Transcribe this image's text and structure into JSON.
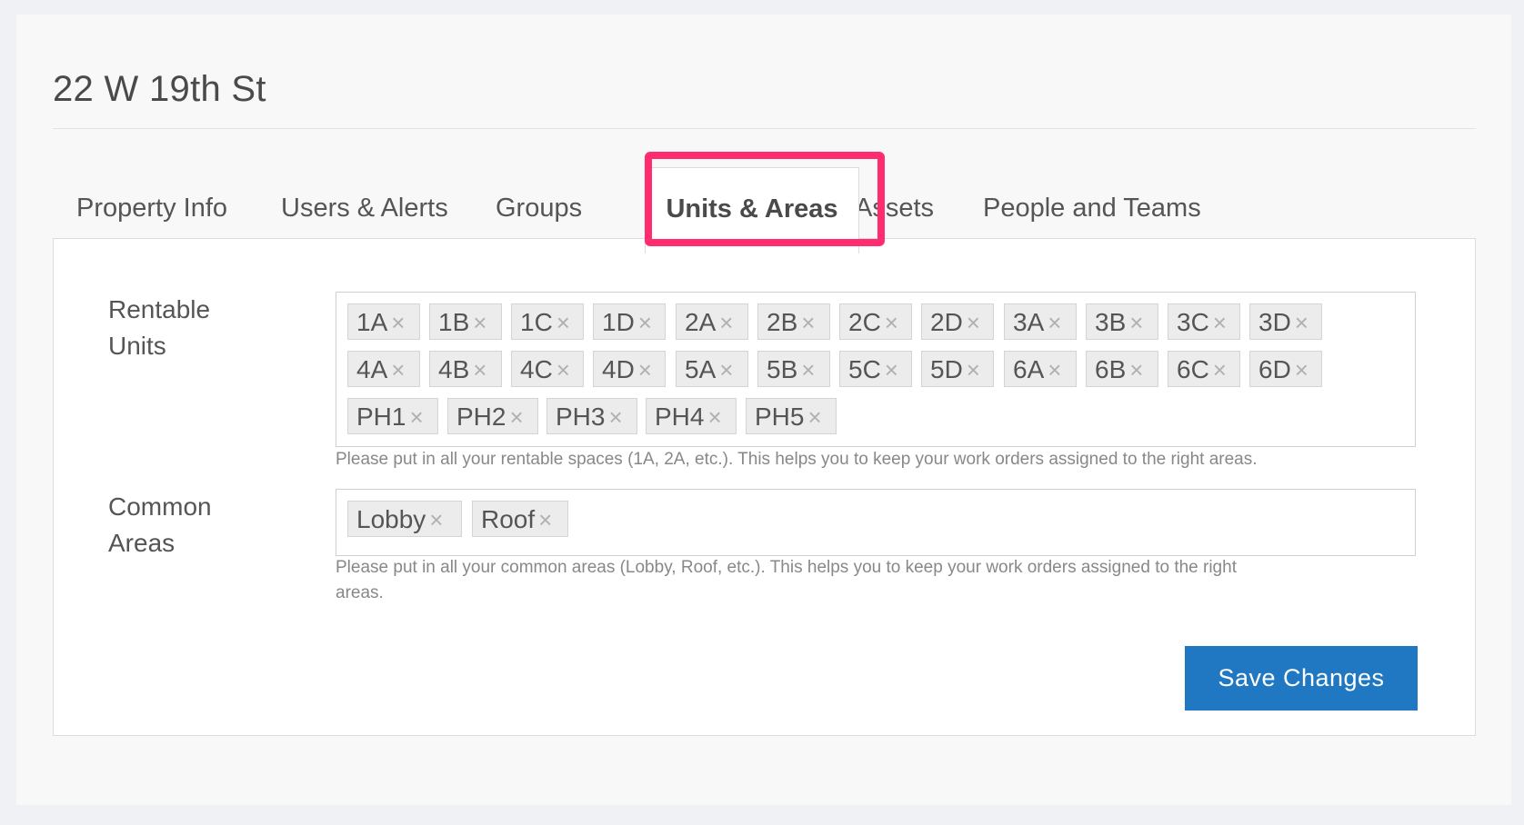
{
  "page": {
    "title": "22 W 19th St"
  },
  "tabs": [
    {
      "label": "Property Info",
      "active": false
    },
    {
      "label": "Users & Alerts",
      "active": false
    },
    {
      "label": "Groups",
      "active": false
    },
    {
      "label": "Units & Areas",
      "active": true
    },
    {
      "label": "Assets",
      "active": false
    },
    {
      "label": "People and Teams",
      "active": false
    }
  ],
  "rentable_units": {
    "label_line1": "Rentable",
    "label_line2": "Units",
    "tags": [
      "1A",
      "1B",
      "1C",
      "1D",
      "2A",
      "2B",
      "2C",
      "2D",
      "3A",
      "3B",
      "3C",
      "3D",
      "4A",
      "4B",
      "4C",
      "4D",
      "5A",
      "5B",
      "5C",
      "5D",
      "6A",
      "6B",
      "6C",
      "6D",
      "PH1",
      "PH2",
      "PH3",
      "PH4",
      "PH5"
    ],
    "help": "Please put in all your rentable spaces (1A, 2A, etc.). This helps you to keep your work orders assigned to the right areas."
  },
  "common_areas": {
    "label_line1": "Common",
    "label_line2": "Areas",
    "tags": [
      "Lobby",
      "Roof"
    ],
    "help_line1": "Please put in all your common areas (Lobby, Roof, etc.). This helps you to keep your work orders assigned to the right",
    "help_line2": "areas."
  },
  "actions": {
    "save_label": "Save Changes"
  },
  "icons": {
    "tag_remove": "close-icon"
  },
  "colors": {
    "accent": "#1f78c1",
    "highlight": "#ff2d6f"
  }
}
